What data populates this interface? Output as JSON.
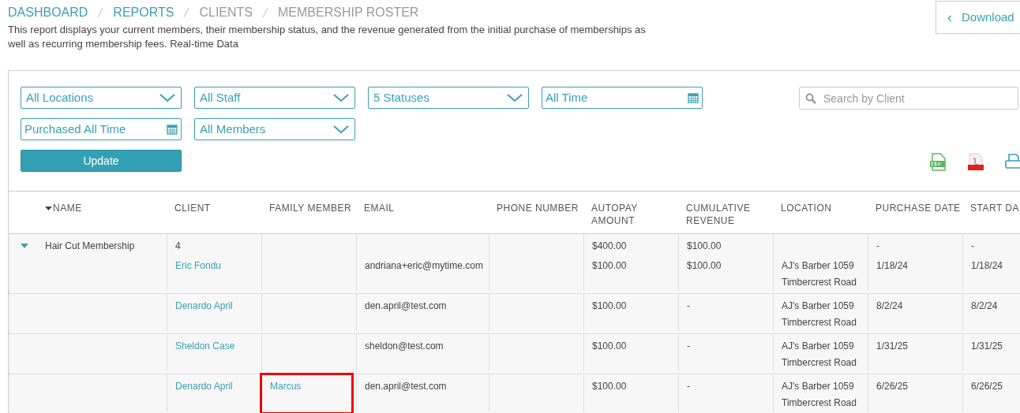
{
  "breadcrumb": [
    {
      "label": "DASHBOARD",
      "link": true
    },
    {
      "label": "REPORTS",
      "link": true
    },
    {
      "label": "CLIENTS",
      "link": false
    },
    {
      "label": "MEMBERSHIP ROSTER",
      "link": false
    }
  ],
  "downloads_button": {
    "label": "Download",
    "icon": "‹"
  },
  "description": "This report displays your current members, their membership status, and the revenue generated from the initial purchase of memberships as well as recurring membership fees. Real-time Data",
  "filters": [
    {
      "kind": "dropdown",
      "value": "All Locations"
    },
    {
      "kind": "dropdown",
      "value": "All Staff"
    },
    {
      "kind": "dropdown",
      "value": "5 Statuses"
    },
    {
      "kind": "date",
      "value": "All Time"
    },
    {
      "kind": "date",
      "value": "Purchased All Time"
    },
    {
      "kind": "dropdown",
      "value": "All Members"
    }
  ],
  "update_button": "Update",
  "search": {
    "placeholder": "Search by Client"
  },
  "export_buttons": [
    {
      "kind": "csv"
    },
    {
      "kind": "pdf"
    },
    {
      "kind": "print"
    }
  ],
  "table": {
    "columns": [
      {
        "label": "NAME",
        "sorted": true
      },
      {
        "label": "CLIENT",
        "sorted": false
      },
      {
        "label": "FAMILY MEMBER",
        "sorted": false
      },
      {
        "label": "EMAIL",
        "sorted": false
      },
      {
        "label": "PHONE NUMBER",
        "sorted": false
      },
      {
        "label": "AUTOPAY AMOUNT",
        "sorted": false
      },
      {
        "label": "CUMULATIVE REVENUE",
        "sorted": false
      },
      {
        "label": "LOCATION",
        "sorted": false
      },
      {
        "label": "PURCHASE DATE",
        "sorted": false
      },
      {
        "label": "START DA",
        "sorted": false
      }
    ],
    "groups": [
      {
        "name": "Hair Cut Membership",
        "expanded": true,
        "client_count": "4",
        "autopay": "$400.00",
        "revenue": "$100.00",
        "purchase_date": "-",
        "start_date": "-",
        "members": [
          {
            "client": "Eric Fondu",
            "email": "andriana+eric@mytime.com",
            "autopay": "$100.00",
            "revenue": "$100.00",
            "location": "AJ's Barber 1059 Timbercrest Road",
            "purchase_date": "1/18/24",
            "start_date": "1/18/24",
            "highlighted": false
          },
          {
            "client": "Denardo April",
            "email": "den.april@test.com",
            "autopay": "$100.00",
            "revenue": "-",
            "location": "AJ's Barber 1059 Timbercrest Road",
            "purchase_date": "8/2/24",
            "start_date": "8/2/24",
            "highlighted": false
          },
          {
            "client": "Sheldon Case",
            "email": "sheldon@test.com",
            "autopay": "$100.00",
            "revenue": "-",
            "location": "AJ's Barber 1059 Timbercrest Road",
            "purchase_date": "1/31/25",
            "start_date": "1/31/25",
            "highlighted": false
          },
          {
            "client": "Denardo April",
            "family_member": "Marcus",
            "email": "den.april@test.com",
            "autopay": "$100.00",
            "revenue": "-",
            "location": "AJ's Barber 1059 Timbercrest Road",
            "purchase_date": "6/26/25",
            "start_date": "6/26/25",
            "highlighted": true
          }
        ]
      }
    ]
  }
}
